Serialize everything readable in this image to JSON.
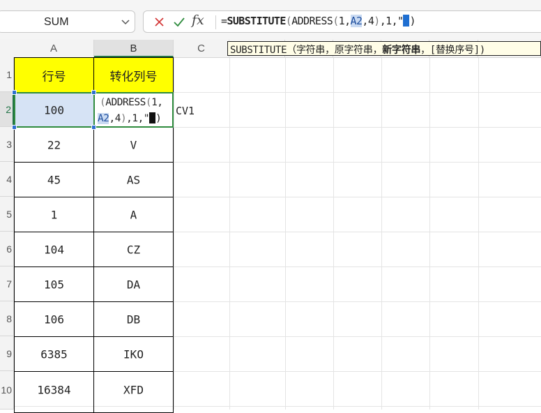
{
  "name_box": {
    "value": "SUM"
  },
  "formula_bar": {
    "fx_label": "fx",
    "parts": [
      {
        "t": "=",
        "c": "plain"
      },
      {
        "t": "SUBSTITUTE",
        "c": "b"
      },
      {
        "t": "(",
        "c": "paren"
      },
      {
        "t": "ADDRESS",
        "c": "plain"
      },
      {
        "t": "(",
        "c": "paren"
      },
      {
        "t": "1,",
        "c": "plain"
      },
      {
        "t": "A2",
        "c": "ref"
      },
      {
        "t": ",4",
        "c": "plain"
      },
      {
        "t": ")",
        "c": "paren"
      },
      {
        "t": ",1,\"",
        "c": "plain"
      },
      {
        "t": "",
        "c": "cur"
      },
      {
        "t": ")",
        "c": "plain"
      }
    ]
  },
  "tooltip": {
    "parts": [
      {
        "t": "SUBSTITUTE（字符串，原字符串，",
        "c": "plain"
      },
      {
        "t": "新字符串",
        "c": "bold"
      },
      {
        "t": "，[替换序号])",
        "c": "plain"
      }
    ]
  },
  "columns": [
    "A",
    "B",
    "C"
  ],
  "rows": [
    "1",
    "2",
    "3",
    "4",
    "5",
    "6",
    "7",
    "8",
    "9",
    "10"
  ],
  "header_row": {
    "a": "行号",
    "b": "转化列号"
  },
  "edit_cell": {
    "line1": [
      {
        "t": "(",
        "c": "paren"
      },
      {
        "t": "ADDRESS",
        "c": "plain"
      },
      {
        "t": "(",
        "c": "paren"
      },
      {
        "t": "1,",
        "c": "plain"
      }
    ],
    "line2": [
      {
        "t": "A2",
        "c": "ref"
      },
      {
        "t": ",4",
        "c": "plain"
      },
      {
        "t": ")",
        "c": "paren"
      },
      {
        "t": ",1,\"",
        "c": "plain"
      },
      {
        "t": "",
        "c": "cur"
      },
      {
        "t": ")",
        "c": "plain"
      }
    ]
  },
  "overflow_text": "CV1",
  "data_rows": [
    {
      "a": "100",
      "b": ""
    },
    {
      "a": "22",
      "b": "V"
    },
    {
      "a": "45",
      "b": "AS"
    },
    {
      "a": "1",
      "b": "A"
    },
    {
      "a": "104",
      "b": "CZ"
    },
    {
      "a": "105",
      "b": "DA"
    },
    {
      "a": "106",
      "b": "DB"
    },
    {
      "a": "6385",
      "b": "IKO"
    },
    {
      "a": "16384",
      "b": "XFD"
    }
  ],
  "colors": {
    "header_fill": "#ffff00",
    "selection": "#2e8b3d",
    "ref_highlight": "#c9daf2"
  }
}
